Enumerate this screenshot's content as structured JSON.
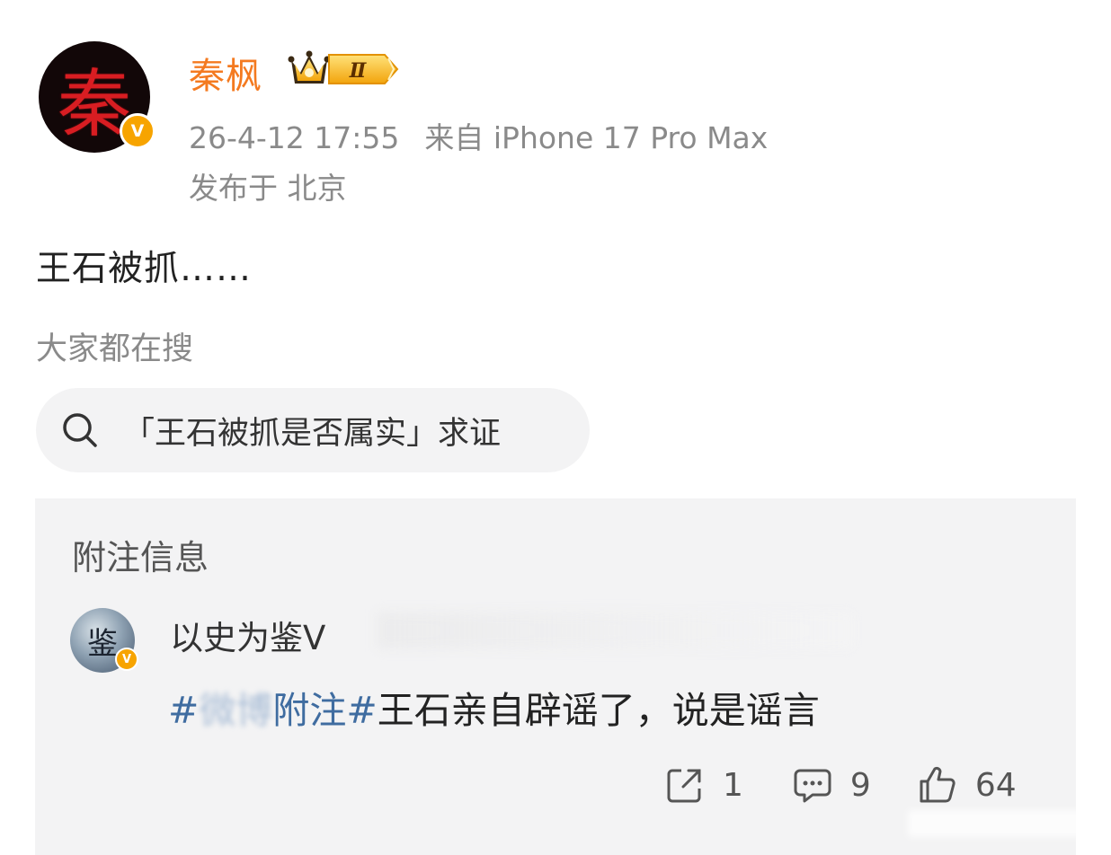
{
  "post": {
    "author": {
      "name": "秦枫",
      "avatar_glyph": "秦",
      "verified_badge": "V",
      "level_badge": "Ⅱ"
    },
    "time": "26-4-12 17:55",
    "source": "来自 iPhone 17 Pro Max",
    "location": "发布于 北京",
    "text": "王石被抓……"
  },
  "search": {
    "label": "大家都在搜",
    "query": "「王石被抓是否属实」求证",
    "icon": "search-icon"
  },
  "note": {
    "title": "附注信息",
    "author": {
      "name": "以史为鉴V",
      "avatar_glyph": "鉴",
      "verified_badge": "V"
    },
    "text": {
      "tag_open": "#",
      "tag_blurred": "微博",
      "tag_label": "附注#",
      "body": "王石亲自辟谣了，说是谣言"
    }
  },
  "actions": {
    "share_count": "1",
    "comment_count": "9",
    "like_count": "64"
  },
  "colors": {
    "username": "#f47a20",
    "tag": "#3f6ca0",
    "meta": "#8a8a8a",
    "badge": "#f7a400",
    "note_bg": "#f3f3f4"
  }
}
